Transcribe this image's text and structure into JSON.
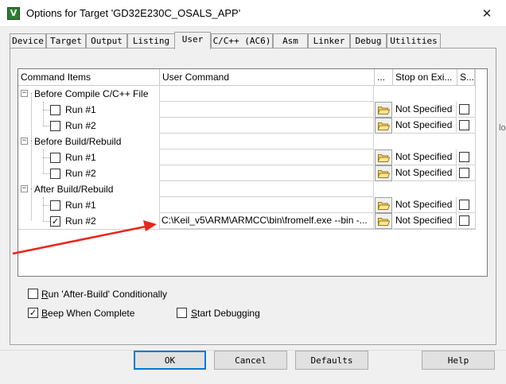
{
  "window": {
    "title": "Options for Target 'GD32E230C_OSALS_APP'",
    "close_glyph": "✕",
    "app_icon_glyph": "V",
    "accent_color": "#0078d7",
    "arrow_color": "#e8261c"
  },
  "tabs": [
    {
      "label": "Device",
      "active": false
    },
    {
      "label": "Target",
      "active": false
    },
    {
      "label": "Output",
      "active": false
    },
    {
      "label": "Listing",
      "active": false
    },
    {
      "label": "User",
      "active": true
    },
    {
      "label": "C/C++ (AC6)",
      "active": false
    },
    {
      "label": "Asm",
      "active": false
    },
    {
      "label": "Linker",
      "active": false
    },
    {
      "label": "Debug",
      "active": false
    },
    {
      "label": "Utilities",
      "active": false
    }
  ],
  "grid": {
    "headers": {
      "command_items": "Command Items",
      "user_command": "User Command",
      "browse": "...",
      "stop_on_exit": "Stop on Exi...",
      "s": "S..."
    },
    "groups": [
      {
        "label": "Before Compile C/C++ File",
        "expander": "−",
        "runs": [
          {
            "label": "Run #1",
            "checked": false,
            "command": "",
            "stop": "Not Specified"
          },
          {
            "label": "Run #2",
            "checked": false,
            "command": "",
            "stop": "Not Specified"
          }
        ]
      },
      {
        "label": "Before Build/Rebuild",
        "expander": "−",
        "runs": [
          {
            "label": "Run #1",
            "checked": false,
            "command": "",
            "stop": "Not Specified"
          },
          {
            "label": "Run #2",
            "checked": false,
            "command": "",
            "stop": "Not Specified"
          }
        ]
      },
      {
        "label": "After Build/Rebuild",
        "expander": "−",
        "runs": [
          {
            "label": "Run #1",
            "checked": false,
            "command": "",
            "stop": "Not Specified"
          },
          {
            "label": "Run #2",
            "checked": true,
            "command": "C:\\Keil_v5\\ARM\\ARMCC\\bin\\fromelf.exe --bin -...",
            "stop": "Not Specified"
          }
        ]
      }
    ],
    "check_glyph": "✓"
  },
  "options": {
    "run_after_build": {
      "label_pre": "",
      "label_u": "R",
      "label_post": "un 'After-Build' Conditionally",
      "checked": false
    },
    "beep": {
      "label_pre": "",
      "label_u": "B",
      "label_post": "eep When Complete",
      "checked": true
    },
    "start_debugging": {
      "label_pre": "",
      "label_u": "S",
      "label_post": "tart Debugging",
      "checked": false
    }
  },
  "buttons": {
    "ok": "OK",
    "cancel": "Cancel",
    "defaults": "Defaults",
    "help": "Help"
  },
  "stray_text": "lo"
}
